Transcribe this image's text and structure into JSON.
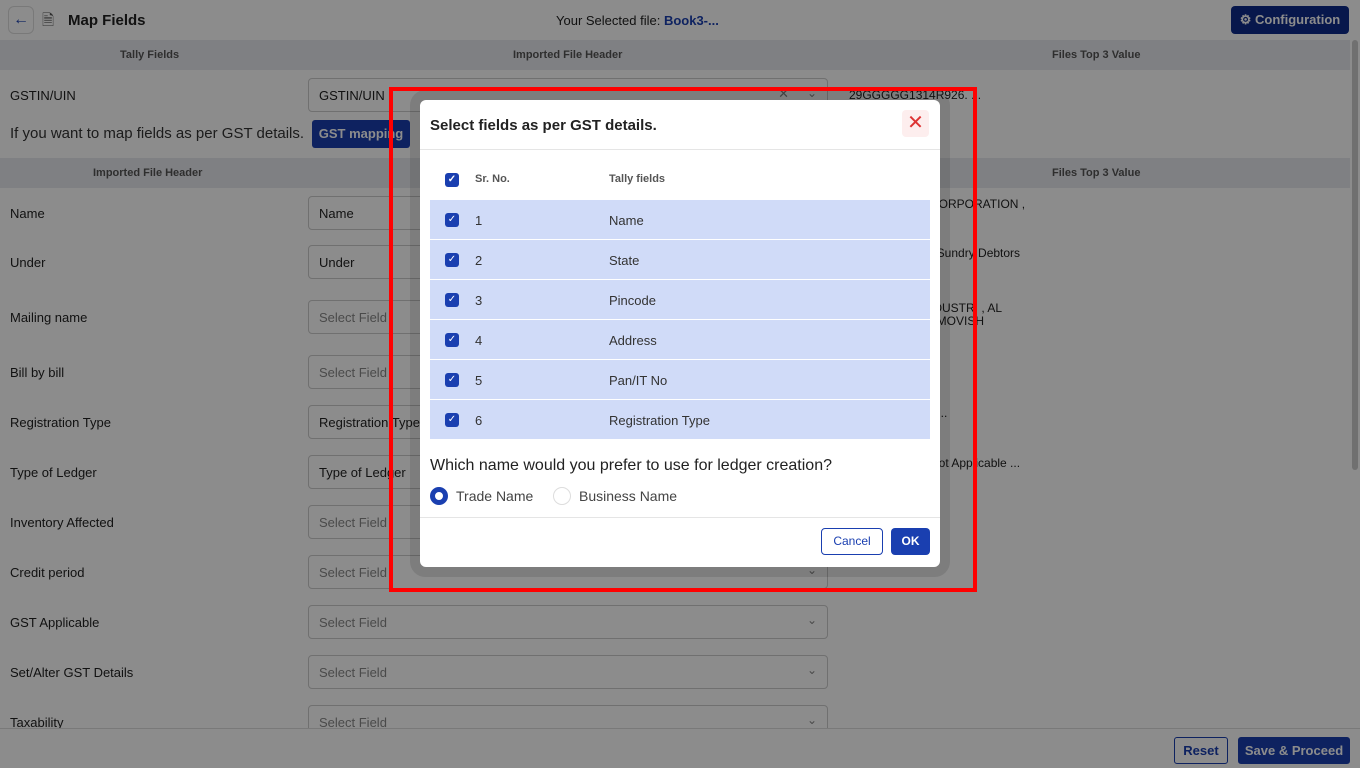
{
  "header": {
    "title": "Map Fields",
    "selected_file_label": "Your Selected file:",
    "selected_file": "Book3-...",
    "configuration": "Configuration"
  },
  "band1": {
    "col1": "Tally Fields",
    "col2": "Imported File Header",
    "col3": "Files Top 3 Value"
  },
  "gstin": {
    "label": "GSTIN/UIN",
    "value": "GSTIN/UIN",
    "top_value": "29GGGGG1314R926. ..."
  },
  "gst_prompt": "If you want to map fields as per GST details.",
  "gst_button": "GST mapping",
  "band2": {
    "col1": "Imported File Header",
    "col3": "Files Top 3 Value"
  },
  "rows": [
    {
      "label": "Name",
      "value": "Name",
      "top": "CORPORATION ,"
    },
    {
      "label": "Under",
      "value": "Under",
      "top": ", Sundry Debtors"
    },
    {
      "label": "Mailing name",
      "value": "Select Field",
      "top": "IDUSTRI , AL\n, MOVISH"
    },
    {
      "label": "Bill by bill",
      "value": "Select Field",
      "top": ""
    },
    {
      "label": "Registration Type",
      "value": "Registration Type",
      "top": "r ..."
    },
    {
      "label": "Type of Ledger",
      "value": "Type of Ledger",
      "top": "Not Applicable ..."
    },
    {
      "label": "Inventory Affected",
      "value": "Select Field",
      "top": ""
    },
    {
      "label": "Credit period",
      "value": "Select Field",
      "top": ""
    },
    {
      "label": "GST Applicable",
      "value": "Select Field",
      "top": ""
    },
    {
      "label": "Set/Alter GST Details",
      "value": "Select Field",
      "top": ""
    },
    {
      "label": "Taxability",
      "value": "Select Field",
      "top": ""
    }
  ],
  "footer": {
    "reset": "Reset",
    "save": "Save & Proceed"
  },
  "modal": {
    "title": "Select fields as per GST details.",
    "col_sr": "Sr. No.",
    "col_field": "Tally fields",
    "items": [
      {
        "sr": "1",
        "field": "Name",
        "checked": true
      },
      {
        "sr": "2",
        "field": "State",
        "checked": true
      },
      {
        "sr": "3",
        "field": "Pincode",
        "checked": true
      },
      {
        "sr": "4",
        "field": "Address",
        "checked": true
      },
      {
        "sr": "5",
        "field": "Pan/IT No",
        "checked": true
      },
      {
        "sr": "6",
        "field": "Registration Type",
        "checked": true
      }
    ],
    "question": "Which name would you prefer to use for ledger creation?",
    "options": [
      {
        "label": "Trade Name",
        "selected": true
      },
      {
        "label": "Business Name",
        "selected": false
      }
    ],
    "cancel": "Cancel",
    "ok": "OK"
  },
  "colors": {
    "primary": "#1a3fb0",
    "row_highlight": "#d0dbf8",
    "annotation": "#ff0000"
  }
}
